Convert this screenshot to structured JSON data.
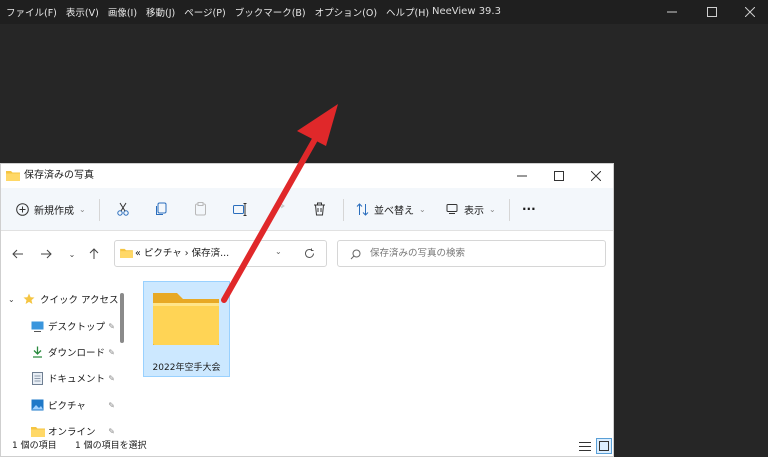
{
  "neeview": {
    "menu": [
      "ファイル(F)",
      "表示(V)",
      "画像(I)",
      "移動(J)",
      "ページ(P)",
      "ブックマーク(B)",
      "オプション(O)",
      "ヘルプ(H)"
    ],
    "title": "NeeView 39.3"
  },
  "explorer": {
    "title": "保存済みの写真",
    "toolbar": {
      "new_label": "新規作成",
      "sort_label": "並べ替え",
      "view_label": "表示",
      "more_label": "···"
    },
    "address": {
      "prefix": "«",
      "crumb1": "ピクチャ",
      "sep": "›",
      "crumb2": "保存済..."
    },
    "search": {
      "placeholder": "保存済みの写真の検索"
    },
    "sidebar": [
      {
        "label": "クイック アクセス"
      },
      {
        "label": "デスクトップ"
      },
      {
        "label": "ダウンロード"
      },
      {
        "label": "ドキュメント"
      },
      {
        "label": "ピクチャ"
      },
      {
        "label": "オンライン"
      }
    ],
    "folder": {
      "name": "2022年空手大会"
    },
    "status": {
      "count": "1 個の項目",
      "selected": "1 個の項目を選択"
    }
  },
  "colors": {
    "arrow": "#e0282a",
    "folder": "#f5c542",
    "selection": "#cce8ff"
  }
}
